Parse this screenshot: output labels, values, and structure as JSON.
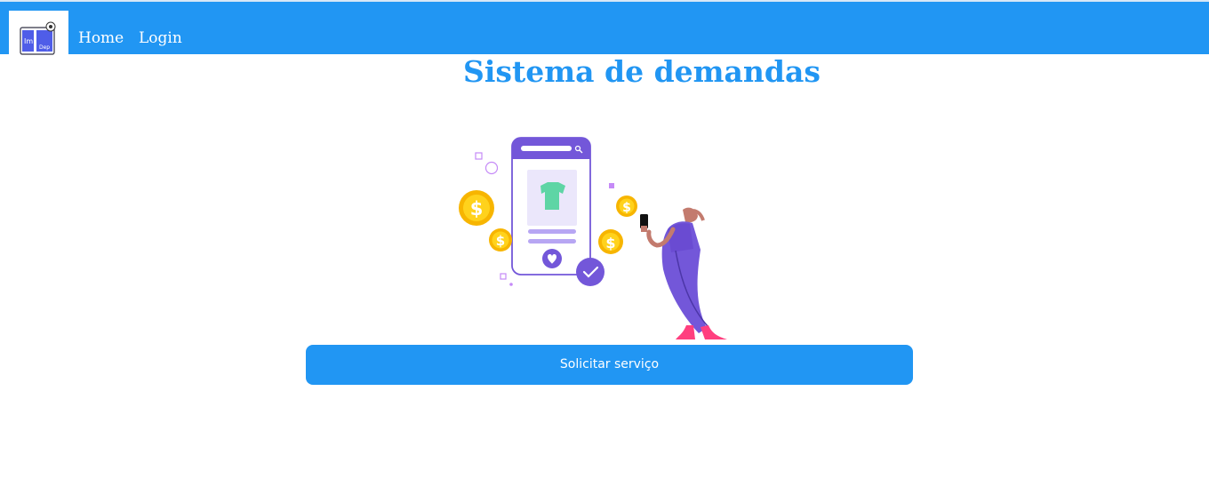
{
  "nav": {
    "logo_icon": "company-logo-icon",
    "links": [
      {
        "label": "Home"
      },
      {
        "label": "Login"
      }
    ]
  },
  "page": {
    "title": "Sistema de demandas"
  },
  "illustration": {
    "icon": "shopping-app-illustration"
  },
  "actions": {
    "request_service_label": "Solicitar serviço"
  },
  "colors": {
    "primary": "#2196f3",
    "illustration_purple": "#7357d9",
    "coin_gold": "#f7b500",
    "shirt_green": "#5ed5a5"
  }
}
